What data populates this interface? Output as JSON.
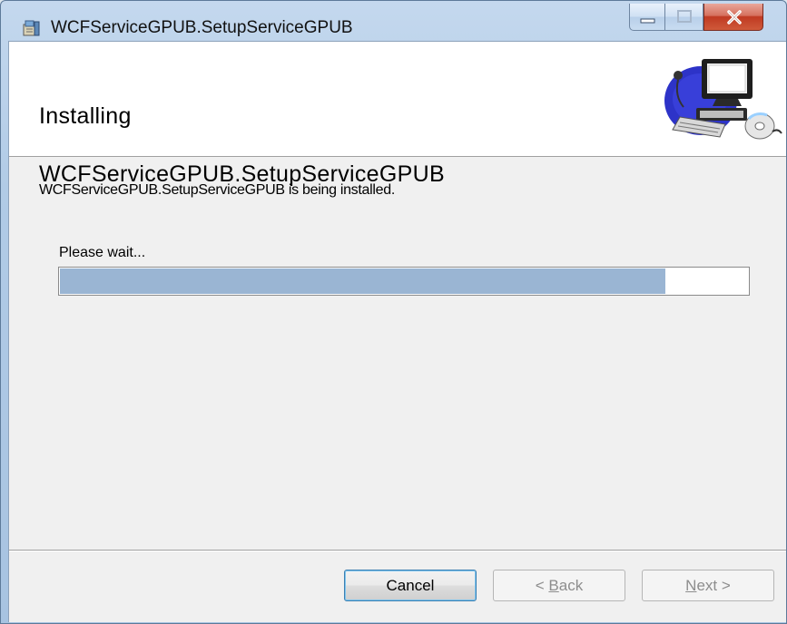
{
  "window": {
    "title": "WCFServiceGPUB.SetupServiceGPUB",
    "app_icon": "installer-package-icon",
    "controls": {
      "minimize_icon": "minimize-icon",
      "maximize_icon": "maximize-icon",
      "close_icon": "close-icon"
    }
  },
  "banner": {
    "title_line1": "Installing",
    "title_line2": "WCFServiceGPUB.SetupServiceGPUB",
    "graphic": "computer-setup-icon"
  },
  "body": {
    "status": "WCFServiceGPUB.SetupServiceGPUB is being installed.",
    "wait_label": "Please wait...",
    "progress_percent": 88
  },
  "buttons": {
    "cancel": "Cancel",
    "back": {
      "arrow": "<",
      "mnemonic": "B",
      "rest": "ack"
    },
    "next": {
      "mnemonic": "N",
      "rest": "ext",
      "arrow": ">"
    }
  },
  "colors": {
    "progress_fill": "#9ab5d3",
    "close_button": "#c03a22"
  }
}
